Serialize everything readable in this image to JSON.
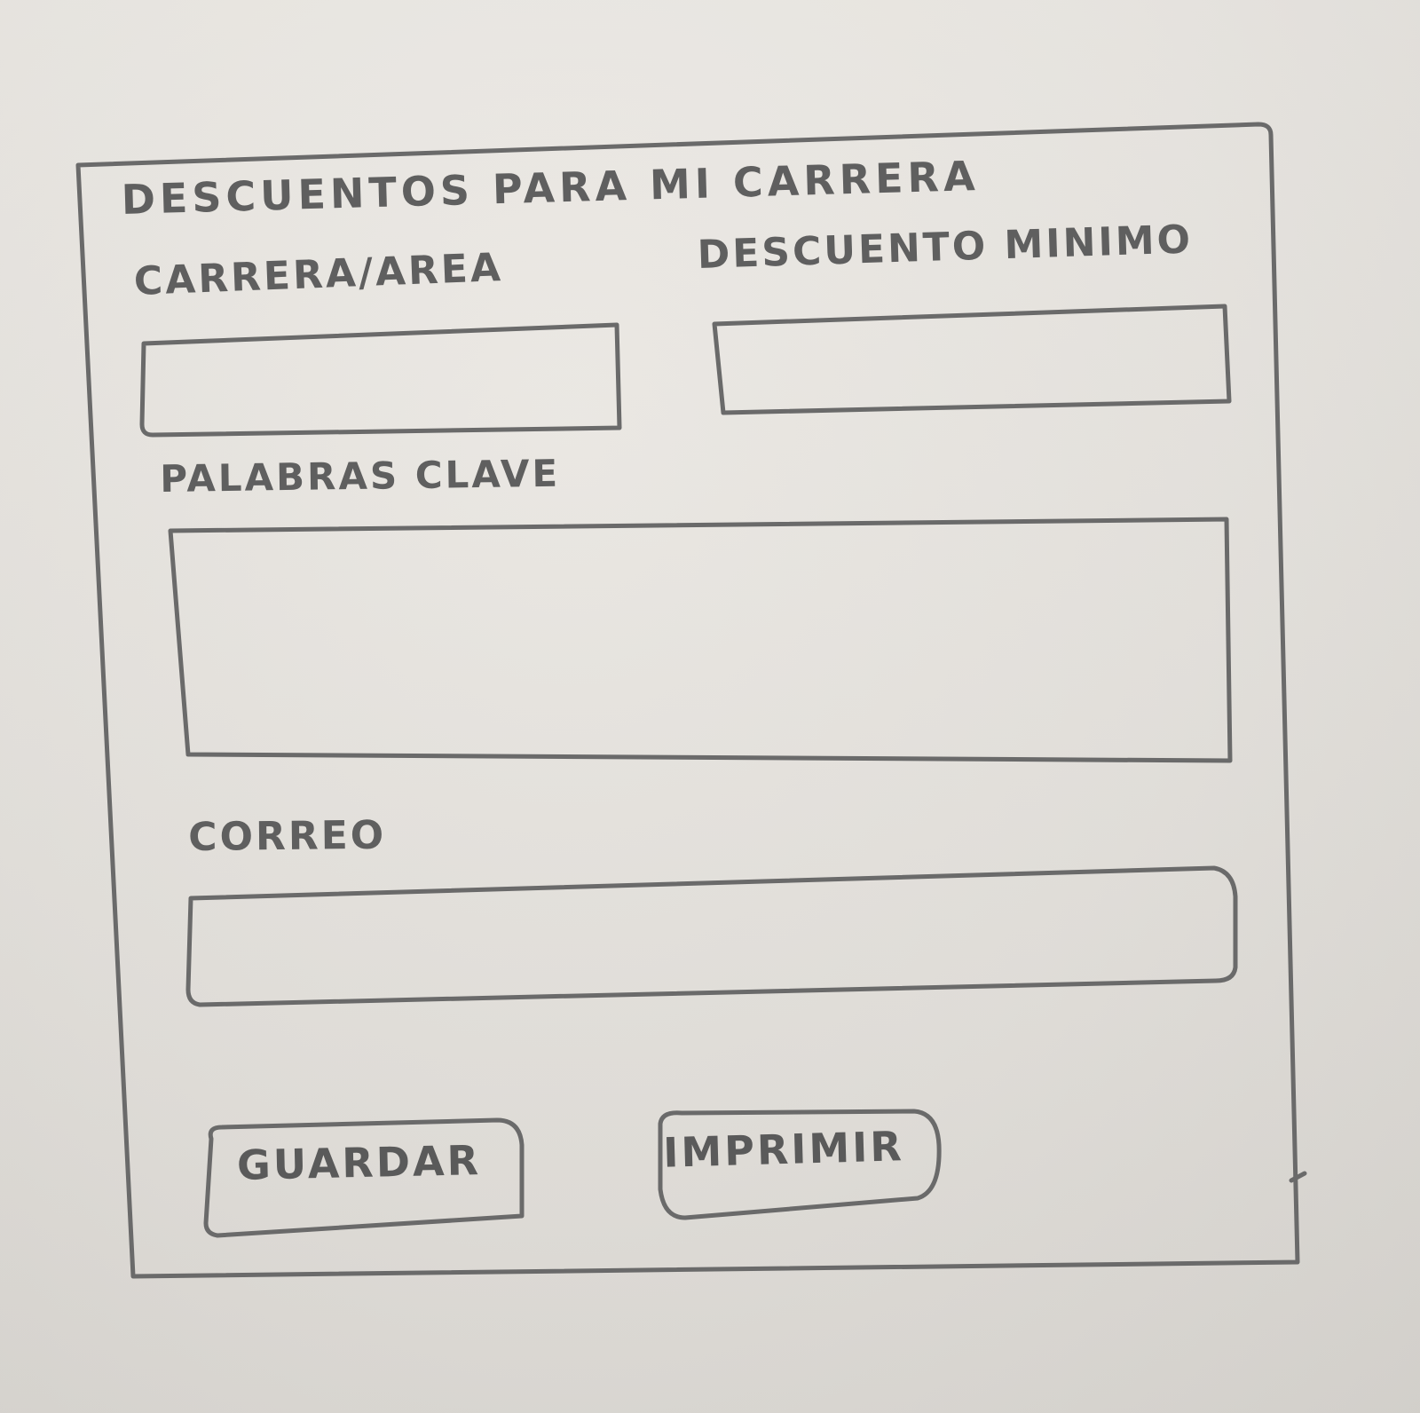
{
  "form": {
    "title": "DESCUENTOS PARA MI CARRERA",
    "fields": {
      "carrera": {
        "label": "CARRERA/AREA",
        "value": ""
      },
      "descuento": {
        "label": "DESCUENTO MINIMO",
        "value": ""
      },
      "palabras": {
        "label": "PALABRAS CLAVE",
        "value": ""
      },
      "correo": {
        "label": "CORREO",
        "value": ""
      }
    },
    "buttons": {
      "guardar": "GUARDAR",
      "imprimir": "IMPRIMIR"
    }
  },
  "colors": {
    "paper": "#e6e3de",
    "pencil": "#666666"
  }
}
